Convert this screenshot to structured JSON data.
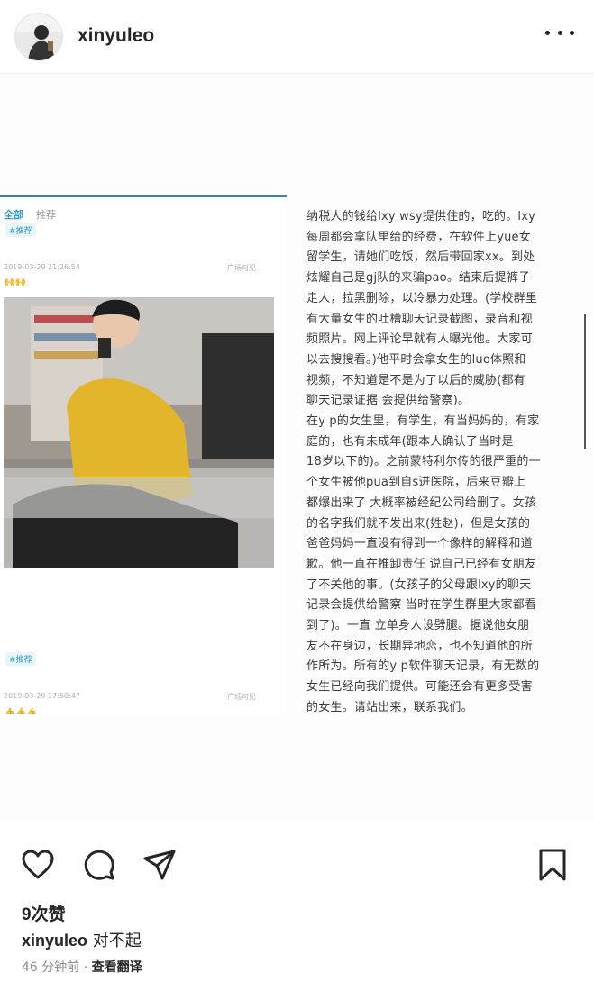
{
  "header": {
    "username": "xinyuleo",
    "more_icon": "more-horizontal-icon"
  },
  "post": {
    "left_screenshot": {
      "tabs": [
        "全部",
        "推荐"
      ],
      "tag1": "#推荐",
      "item1_date": "2019-03-29 21:26:54",
      "item1_visibility": "广场可见",
      "item1_emoji": "🙌🙌",
      "tag2": "#推荐",
      "item2_date": "2019-03-29 17:50:47",
      "item2_visibility": "广场可见",
      "item2_emoji": "👍👍👍"
    },
    "text": "纳税人的钱给lxy wsy提供住的，吃的。lxy\n每周都会拿队里给的经费，在软件上yue女\n留学生，请她们吃饭，然后带回家xx。到处\n炫耀自己是gj队的来骗pao。结束后提裤子\n走人，拉黑删除，以冷暴力处理。(学校群里\n有大量女生的吐槽聊天记录截图，录音和视\n频照片。网上评论早就有人曝光他。大家可\n以去搜搜看。)他平时会拿女生的luo体照和\n视频，不知道是不是为了以后的威胁(都有\n聊天记录证据 会提供给警察)。\n在y p的女生里，有学生，有当妈妈的，有家\n庭的，也有未成年(跟本人确认了当时是\n18岁以下的)。之前蒙特利尔传的很严重的一\n个女生被他pua到自s进医院，后来豆瓣上\n都爆出来了 大概率被经纪公司给删了。女孩\n的名字我们就不发出来(姓赵)，但是女孩的\n爸爸妈妈一直没有得到一个像样的解释和道\n歉。他一直在推卸责任 说自己已经有女朋友\n了不关他的事。(女孩子的父母跟lxy的聊天\n记录会提供给警察 当时在学生群里大家都看\n到了)。一直 立单身人设劈腿。据说他女朋\n友不在身边，长期异地恋，也不知道他的所\n作所为。所有的y p软件聊天记录，有无数的\n女生已经向我们提供。可能还会有更多受害\n的女生。请站出来，联系我们。"
  },
  "actions": {
    "like_icon": "heart-icon",
    "comment_icon": "comment-icon",
    "share_icon": "send-icon",
    "save_icon": "bookmark-icon"
  },
  "likes": "9次赞",
  "caption": {
    "username": "xinyuleo",
    "text": "对不起"
  },
  "timestamp": "46 分钟前",
  "separator": "·",
  "translate_label": "查看翻译"
}
